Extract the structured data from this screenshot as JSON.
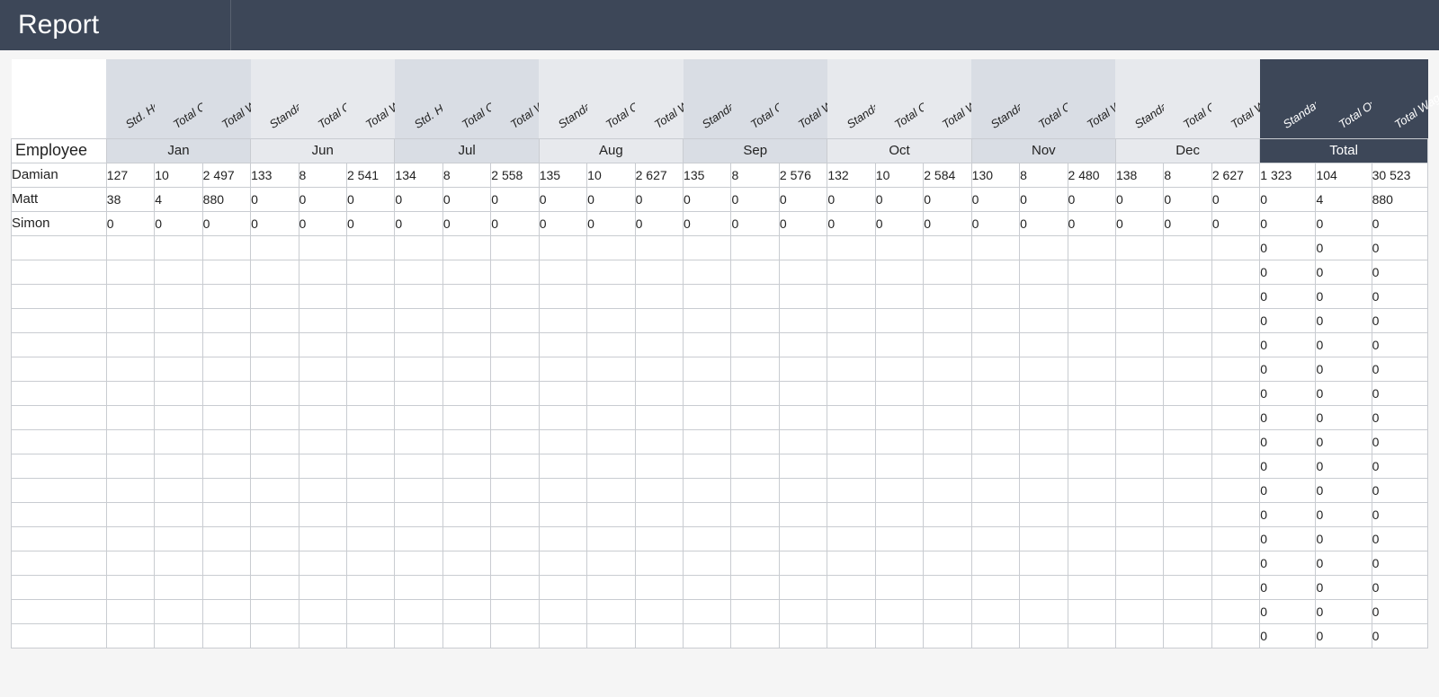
{
  "title": "Report",
  "employee_header": "Employee",
  "sub_headers_short": [
    "Std. Hours",
    "Total Overtime",
    "Total Wage"
  ],
  "sub_headers_long": [
    "Standard Hours",
    "Total Overtime",
    "Total Wage"
  ],
  "months": [
    {
      "label": "Jan",
      "short_labels": true
    },
    {
      "label": "Jun",
      "short_labels": false
    },
    {
      "label": "Jul",
      "short_labels": true
    },
    {
      "label": "Aug",
      "short_labels": false
    },
    {
      "label": "Sep",
      "short_labels": false
    },
    {
      "label": "Oct",
      "short_labels": false
    },
    {
      "label": "Nov",
      "short_labels": false
    },
    {
      "label": "Dec",
      "short_labels": false
    }
  ],
  "total_label": "Total",
  "total_sub_headers": [
    "Standard Hours",
    "Total Overtime",
    "Total Wage"
  ],
  "blank_rows": 17,
  "employees": [
    {
      "name": "Damian",
      "values": {
        "Jan": [
          "127",
          "10",
          "2 497"
        ],
        "Jun": [
          "133",
          "8",
          "2 541"
        ],
        "Jul": [
          "134",
          "8",
          "2 558"
        ],
        "Aug": [
          "135",
          "10",
          "2 627"
        ],
        "Sep": [
          "135",
          "8",
          "2 576"
        ],
        "Oct": [
          "132",
          "10",
          "2 584"
        ],
        "Nov": [
          "130",
          "8",
          "2 480"
        ],
        "Dec": [
          "138",
          "8",
          "2 627"
        ]
      },
      "total": [
        "1 323",
        "104",
        "30 523"
      ]
    },
    {
      "name": "Matt",
      "values": {
        "Jan": [
          "38",
          "4",
          "880"
        ],
        "Jun": [
          "0",
          "0",
          "0"
        ],
        "Jul": [
          "0",
          "0",
          "0"
        ],
        "Aug": [
          "0",
          "0",
          "0"
        ],
        "Sep": [
          "0",
          "0",
          "0"
        ],
        "Oct": [
          "0",
          "0",
          "0"
        ],
        "Nov": [
          "0",
          "0",
          "0"
        ],
        "Dec": [
          "0",
          "0",
          "0"
        ]
      },
      "total": [
        "0",
        "4",
        "880"
      ]
    },
    {
      "name": "Simon",
      "values": {
        "Jan": [
          "0",
          "0",
          "0"
        ],
        "Jun": [
          "0",
          "0",
          "0"
        ],
        "Jul": [
          "0",
          "0",
          "0"
        ],
        "Aug": [
          "0",
          "0",
          "0"
        ],
        "Sep": [
          "0",
          "0",
          "0"
        ],
        "Oct": [
          "0",
          "0",
          "0"
        ],
        "Nov": [
          "0",
          "0",
          "0"
        ],
        "Dec": [
          "0",
          "0",
          "0"
        ]
      },
      "total": [
        "0",
        "0",
        "0"
      ]
    }
  ],
  "blank_total": [
    "0",
    "0",
    "0"
  ]
}
